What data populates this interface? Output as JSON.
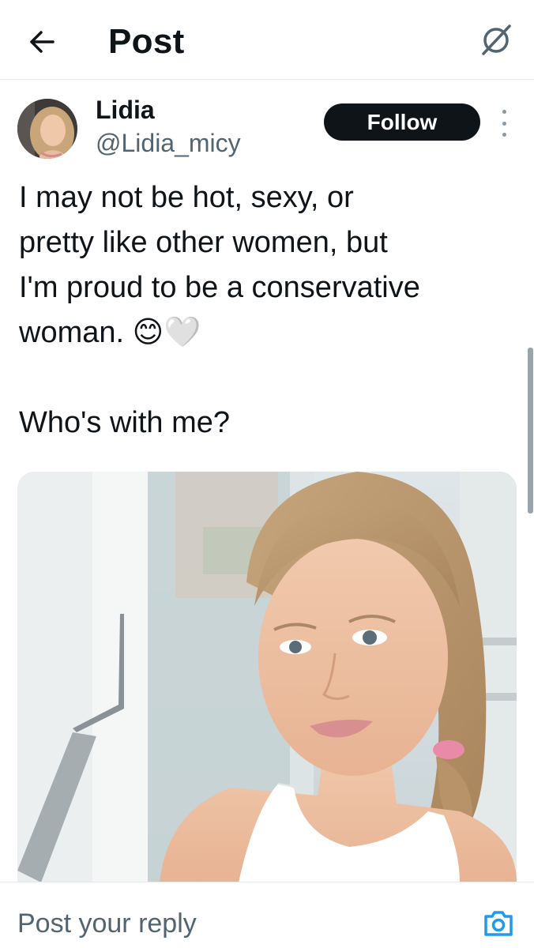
{
  "header": {
    "title": "Post",
    "back_icon": "arrow-left-icon",
    "right_icon": "slashed-circle-icon"
  },
  "author": {
    "name": "Lidia",
    "handle": "@Lidia_micy",
    "follow_label": "Follow",
    "more_icon": "vertical-ellipsis-icon"
  },
  "post": {
    "text": "I may not be hot, sexy, or\npretty like other women, but\nI'm proud to be a conservative\nwoman. 😊🤍\n\nWho's with me?"
  },
  "reply": {
    "placeholder": "Post your reply",
    "camera_icon": "camera-icon"
  },
  "colors": {
    "text": "#0f1419",
    "secondary": "#536471",
    "follow_bg": "#0f1419",
    "accent": "#1d9bf0",
    "divider": "#e6e9ec"
  }
}
